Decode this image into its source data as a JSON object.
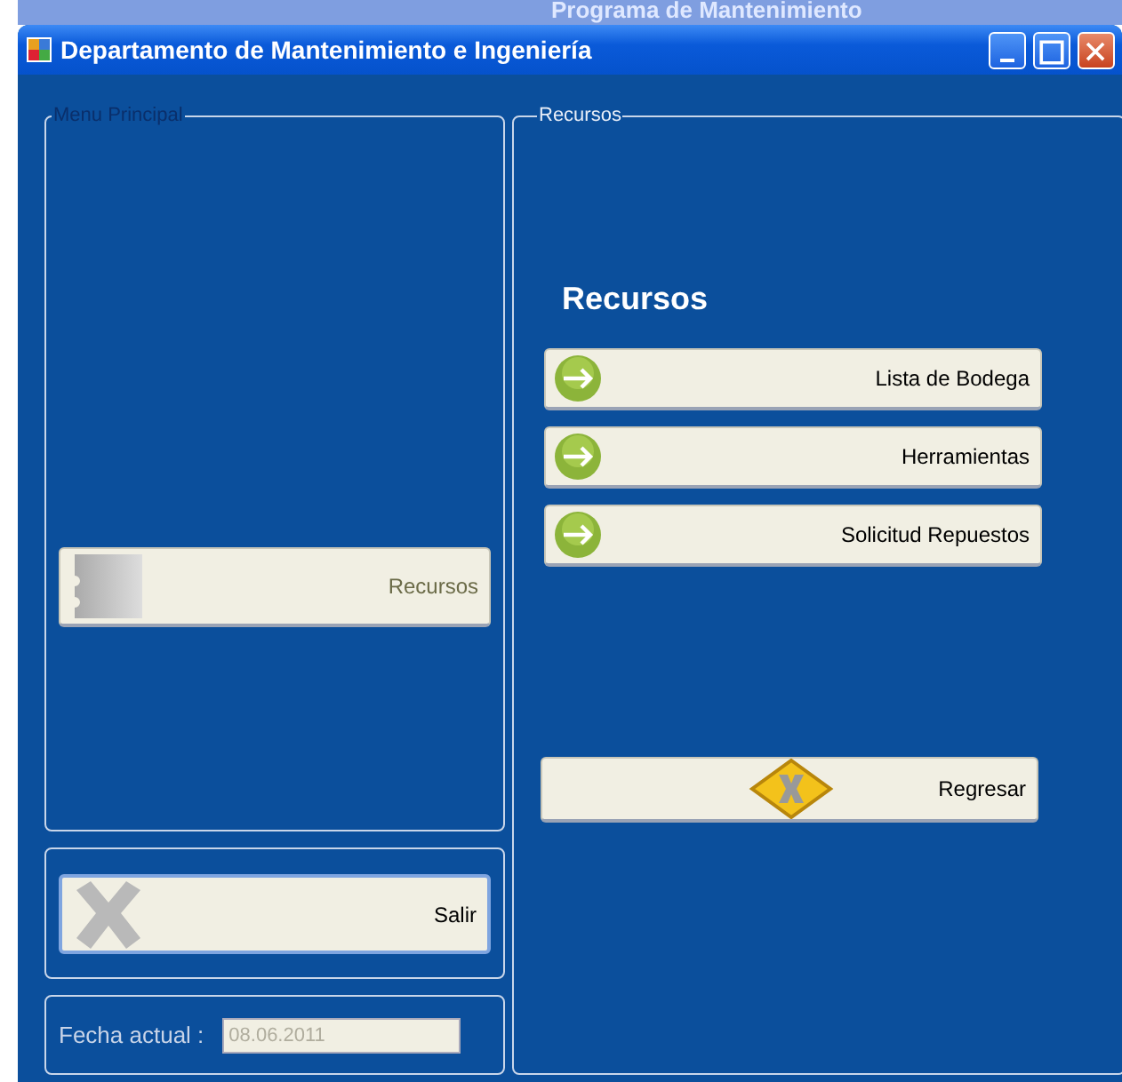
{
  "background_window": {
    "title": "Programa de Mantenimiento"
  },
  "window": {
    "title": "Departamento de Mantenimiento e Ingeniería"
  },
  "menu_principal": {
    "legend": "Menu Principal",
    "buttons": [
      {
        "label": "Recursos",
        "kind": "blank"
      }
    ]
  },
  "exit_button": {
    "label": "Salir"
  },
  "date": {
    "label": "Fecha actual :",
    "value": "08.06.2011",
    "disabled": true
  },
  "recursos": {
    "legend": "Recursos",
    "heading": "Recursos",
    "buttons": [
      {
        "label": "Lista de Bodega",
        "kind": "arrow"
      },
      {
        "label": "Herramientas",
        "kind": "arrow"
      },
      {
        "label": "Solicitud Repuestos",
        "kind": "arrow"
      }
    ],
    "back_button": {
      "label": "Regresar"
    }
  }
}
